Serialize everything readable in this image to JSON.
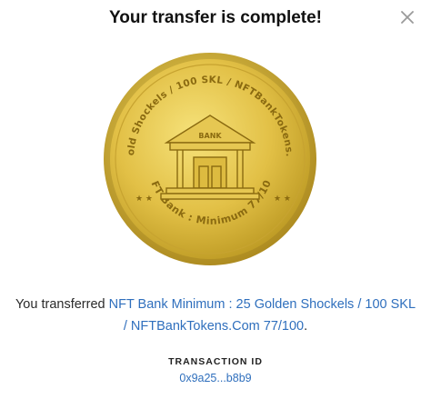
{
  "header": {
    "title": "Your transfer is complete!"
  },
  "coin": {
    "arc_top": "25 Gold Shockels / 100 SKL / NFTBankTokens.Com",
    "arc_bottom": "NFT Bank : Minimum 77/100",
    "building_sign": "BANK",
    "stars": "★ ★",
    "colors": {
      "gold_light": "#f3dd6a",
      "gold_mid": "#dcb93a",
      "gold_dark": "#a9861c",
      "engrave": "#8a6a10"
    }
  },
  "message": {
    "prefix": "You transferred ",
    "link_text": "NFT Bank Minimum : 25 Golden Shockels / 100 SKL / NFTBankTokens.Com 77/100",
    "suffix": "."
  },
  "transaction": {
    "label": "TRANSACTION ID",
    "id": "0x9a25...b8b9"
  },
  "icons": {
    "close": "close-icon"
  },
  "colors": {
    "link": "#2f6fbd",
    "title": "#111111",
    "close": "#9a9a9a"
  }
}
